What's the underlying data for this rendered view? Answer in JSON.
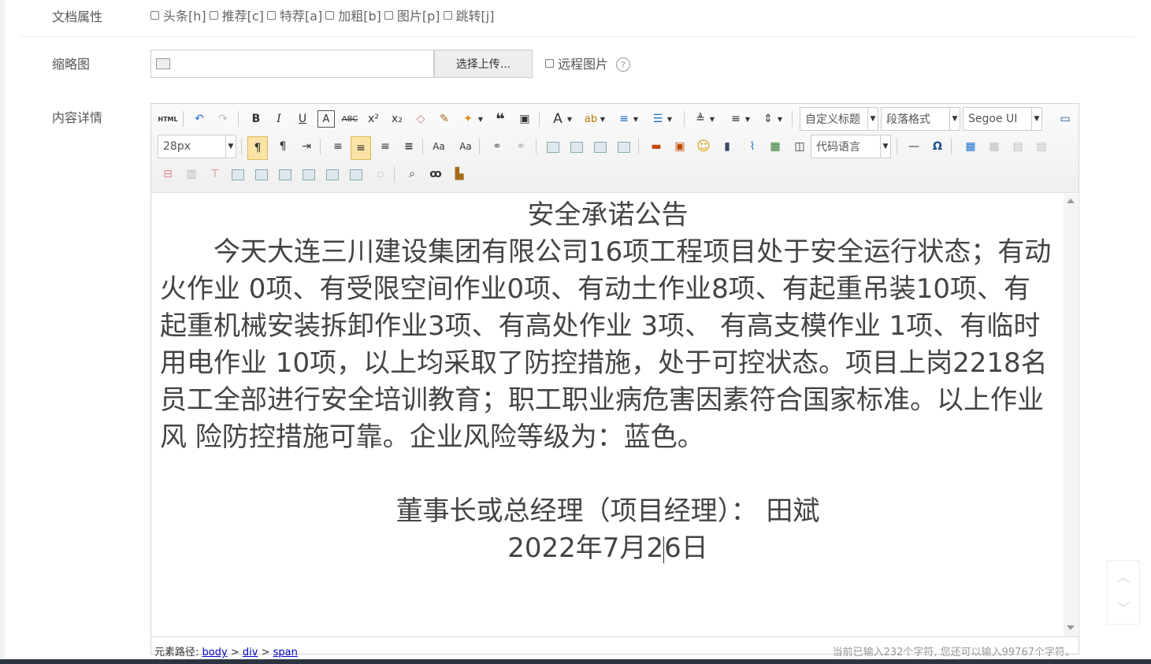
{
  "form": {
    "attr_label": "文档属性",
    "attrs": [
      "头条[h]",
      "推荐[c]",
      "特荐[a]",
      "加粗[b]",
      "图片[p]",
      "跳转[j]"
    ],
    "thumb_label": "缩略图",
    "upload_label": "选择上传...",
    "remote_label": "远程图片",
    "help_glyph": "?",
    "content_label": "内容详情"
  },
  "toolbar": {
    "html_label": "HTML",
    "custom_title": "自定义标题",
    "paragraph": "段落格式",
    "font_family": "Segoe UI",
    "font_size": "28px",
    "code_lang": "代码语言"
  },
  "content": {
    "title": "安全承诺公告",
    "body": "今天大连三川建设集团有限公司16项工程项目处于安全运行状态；有动火作业 0项、有受限空间作业0项、有动土作业8项、有起重吊装10项、有起重机械安装拆卸作业3项、有高处作业 3项、 有高支模作业 1项、有临时用电作业 10项，以上均采取了防控措施，处于可控状态。项目上岗2218名员工全部进行安全培训教育；职工职业病危害因素符合国家标准。以上作业风 险防控措施可靠。企业风险等级为：蓝色。",
    "signer": "董事长或总经理（项目经理）：  田斌",
    "date_a": "2022年7月2",
    "date_b": "6日"
  },
  "status": {
    "path_prefix": "元素路径:",
    "path": [
      "body",
      "div",
      "span"
    ],
    "sep": ">",
    "count": "当前已输入232个字符, 您还可以输入99767个字符。"
  }
}
